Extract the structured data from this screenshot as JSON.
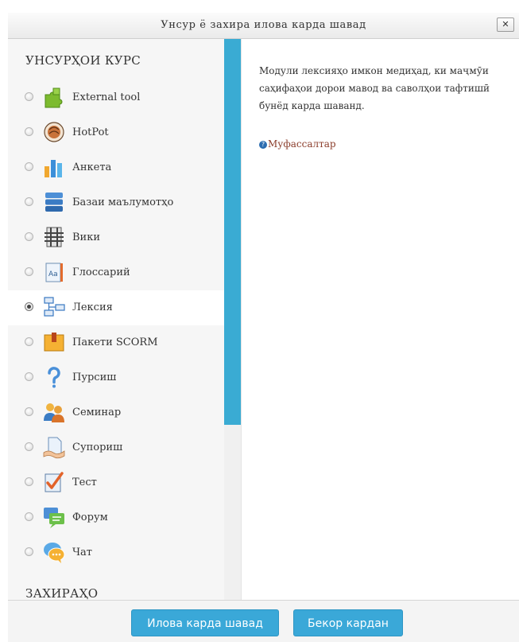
{
  "dialog": {
    "title": "Унсур ё захира илова карда шавад",
    "close_label": "✕"
  },
  "sections": {
    "activities_heading": "УНСУРҲОИ КУРС",
    "resources_heading": "ЗАХИРАҲО"
  },
  "activities": [
    {
      "label": "External tool",
      "icon": "external-tool-icon",
      "selected": false
    },
    {
      "label": "HotPot",
      "icon": "hotpot-icon",
      "selected": false
    },
    {
      "label": "Анкета",
      "icon": "survey-icon",
      "selected": false
    },
    {
      "label": "Базаи маълумотҳо",
      "icon": "database-icon",
      "selected": false
    },
    {
      "label": "Вики",
      "icon": "wiki-icon",
      "selected": false
    },
    {
      "label": "Глоссарий",
      "icon": "glossary-icon",
      "selected": false
    },
    {
      "label": "Лексия",
      "icon": "lesson-icon",
      "selected": true
    },
    {
      "label": "Пакети SCORM",
      "icon": "scorm-icon",
      "selected": false
    },
    {
      "label": "Пурсиш",
      "icon": "question-icon",
      "selected": false
    },
    {
      "label": "Семинар",
      "icon": "workshop-icon",
      "selected": false
    },
    {
      "label": "Супориш",
      "icon": "assignment-icon",
      "selected": false
    },
    {
      "label": "Тест",
      "icon": "quiz-icon",
      "selected": false
    },
    {
      "label": "Форум",
      "icon": "forum-icon",
      "selected": false
    },
    {
      "label": "Чат",
      "icon": "chat-icon",
      "selected": false
    }
  ],
  "details": {
    "description": "Модули лексияҳо имкон медиҳад, ки маҷмӯи саҳифаҳои дорои мавод ва саволҳои тафтишӣ бунёд карда шаванд.",
    "more_help_label": "Муфассалтар",
    "help_glyph": "?"
  },
  "footer": {
    "add_label": "Илова карда шавад",
    "cancel_label": "Бекор кардан"
  },
  "colors": {
    "accent": "#3aa8d8",
    "scrollbar": "#3aabd3",
    "link": "#8b3d2b"
  }
}
